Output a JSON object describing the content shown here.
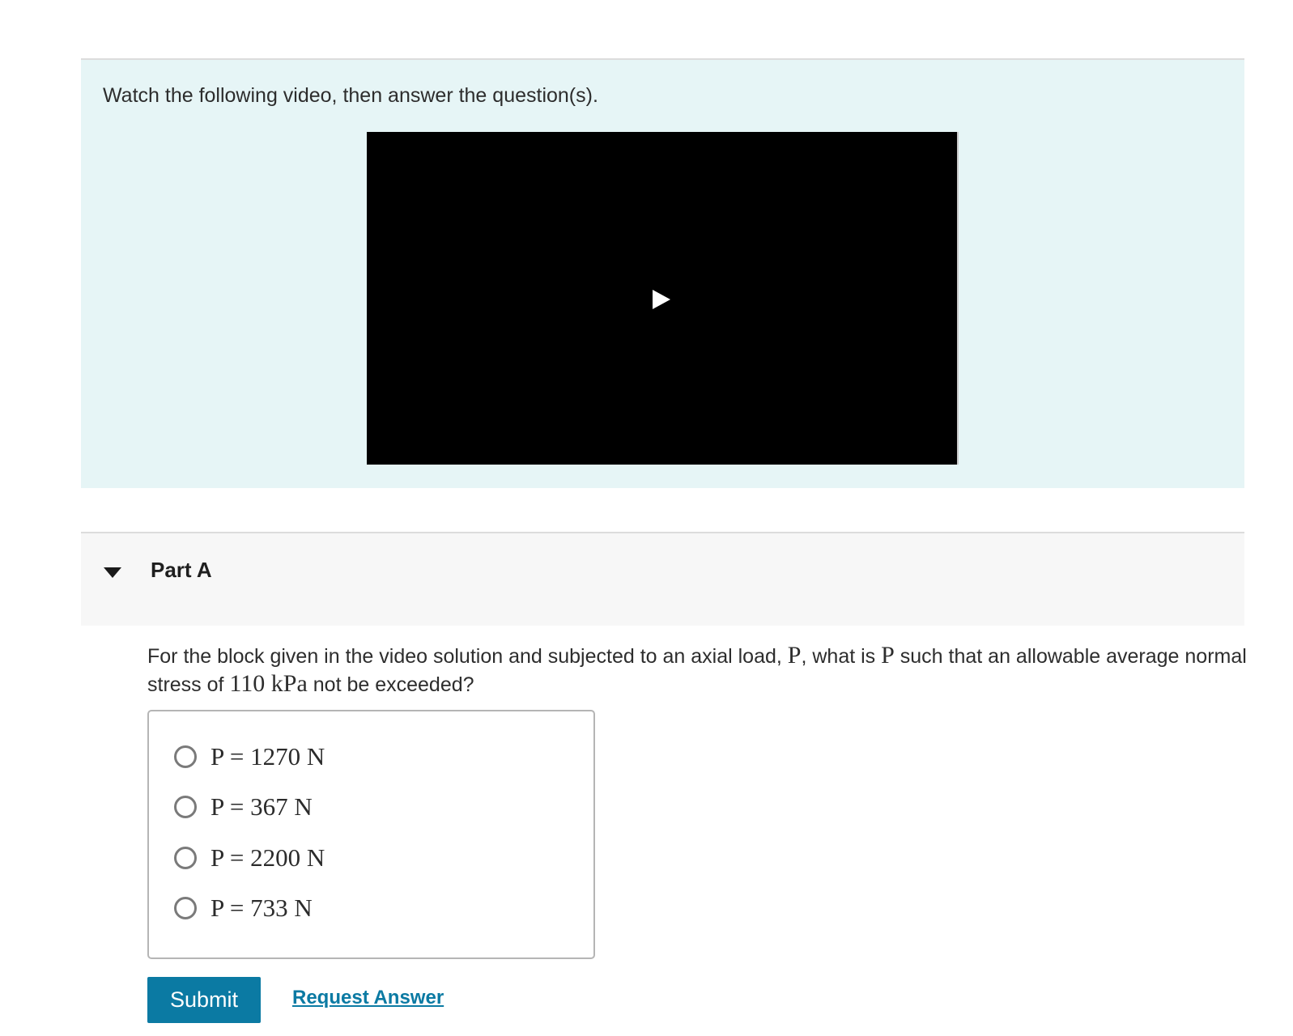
{
  "intro": {
    "text": "Watch the following video, then answer the question(s)."
  },
  "video": {
    "play_icon": "play-icon"
  },
  "part": {
    "title": "Part A",
    "caret_icon": "caret-down-icon"
  },
  "question": {
    "text_1": "For the block given in the video solution and subjected to an axial load, ",
    "var_1": "P",
    "text_2": ", what is ",
    "var_2": "P",
    "text_3": " such that an allowable average normal stress of ",
    "stress_value": "110 kPa",
    "text_4": " not be exceeded?"
  },
  "choices": [
    {
      "label": "P = 1270 N",
      "selected": false
    },
    {
      "label": "P = 367 N",
      "selected": false
    },
    {
      "label": "P = 2200 N",
      "selected": false
    },
    {
      "label": "P = 733 N",
      "selected": false
    }
  ],
  "actions": {
    "submit_label": "Submit",
    "request_answer_label": "Request Answer"
  },
  "colors": {
    "intro_panel_bg": "#e6f5f6",
    "part_header_bg": "#f7f7f7",
    "accent": "#0b7aa3"
  }
}
